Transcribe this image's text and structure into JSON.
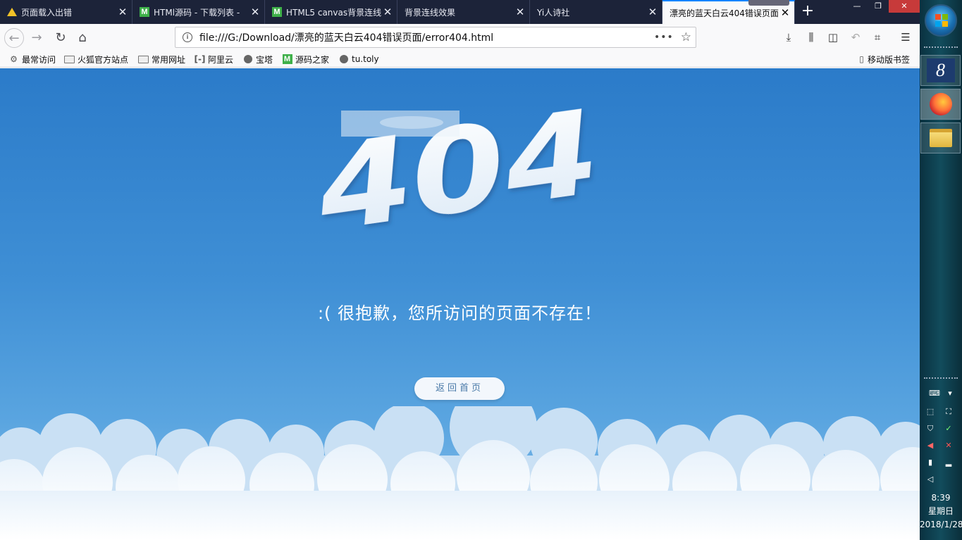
{
  "browser": {
    "tabs": [
      {
        "title": "页面载入出错",
        "icon": "warning-icon",
        "active": false
      },
      {
        "title": "HTMl源码 - 下载列表 -",
        "icon": "m-site-icon",
        "active": false
      },
      {
        "title": "HTML5 canvas背景连线",
        "icon": "m-site-icon",
        "active": false
      },
      {
        "title": "背景连线效果",
        "icon": "",
        "active": false
      },
      {
        "title": "Yi人诗社",
        "icon": "",
        "active": false
      },
      {
        "title": "漂亮的蓝天白云404错误页面",
        "icon": "",
        "active": true
      }
    ],
    "new_tab": "+",
    "url": "file:///G:/Download/漂亮的蓝天白云404错误页面/error404.html",
    "url_dots": "•••",
    "bookmarks": [
      {
        "label": "最常访问",
        "icon": "gear-icon"
      },
      {
        "label": "火狐官方站点",
        "icon": "folder-icon"
      },
      {
        "label": "常用网址",
        "icon": "folder-icon"
      },
      {
        "label": "阿里云",
        "icon": "aliyun-icon"
      },
      {
        "label": "宝塔",
        "icon": "globe-icon"
      },
      {
        "label": "源码之家",
        "icon": "m-site-icon"
      },
      {
        "label": "tu.toly",
        "icon": "globe-icon"
      }
    ],
    "mobile_bookmarks": "移动版书签"
  },
  "page": {
    "error_code": "404",
    "message": ":(  很抱歉，您所访问的页面不存在！",
    "home_button": "返回首页",
    "colors": {
      "sky_top": "#2b7bc9",
      "sky_bottom": "#8cc2ec",
      "cloud": "#ffffff"
    }
  },
  "taskbar": {
    "time": "8:39",
    "weekday": "星期日",
    "date": "2018/1/28"
  }
}
